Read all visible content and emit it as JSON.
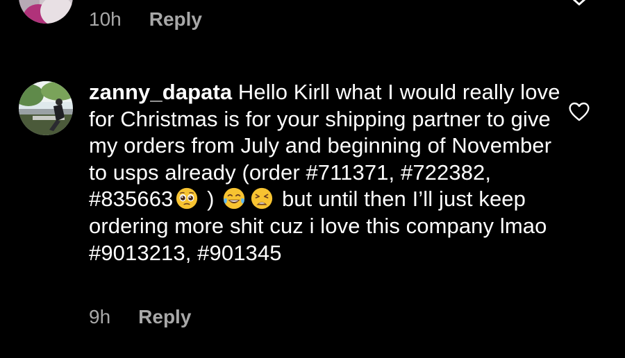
{
  "previous_comment": {
    "time": "10h",
    "reply_label": "Reply",
    "avatar_icon": "user-avatar",
    "like_icon": "heart-outline-icon"
  },
  "comment": {
    "username": "zanny_dapata",
    "text_1": " Hello Kirll what I would really love for Christmas is for your shipping partner to give my orders from July and beginning of November to usps already (order ",
    "hashtag_1": "#711371",
    "sep_1": ", ",
    "hashtag_2": "#722382",
    "sep_2": ", ",
    "hashtag_3": "#835663",
    "text_2": " ) ",
    "text_3": " but until then I’ll just keep ordering more shit cuz i love this company lmao ",
    "hashtag_4": "#9013213",
    "sep_3": ", ",
    "hashtag_5": "#901345",
    "emojis": [
      "pleading-face-emoji",
      "face-with-tears-of-joy-emoji",
      "weary-face-emoji"
    ],
    "time": "9h",
    "reply_label": "Reply",
    "like_icon": "heart-outline-icon"
  },
  "colors": {
    "background": "#000000",
    "text": "#ffffff",
    "meta": "#a8a8a8",
    "emoji_yellow": "#f7c331"
  }
}
